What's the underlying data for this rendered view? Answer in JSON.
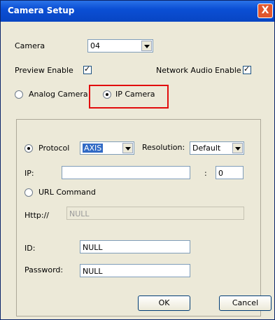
{
  "window": {
    "title": "Camera Setup",
    "close_glyph": "X"
  },
  "camera": {
    "label": "Camera",
    "selected": "04"
  },
  "preview_enable": {
    "label": "Preview Enable",
    "checked": true,
    "mark": "✓"
  },
  "network_audio_enable": {
    "label": "Network Audio Enable",
    "checked": true,
    "mark": "✓"
  },
  "camera_type": {
    "analog_label": "Analog Camera",
    "ip_label": "IP Camera",
    "selected": "IP Camera"
  },
  "ip_panel": {
    "protocol_label": "Protocol",
    "protocol_value": "AXIS",
    "resolution_label": "Resolution:",
    "resolution_value": "Default",
    "ip_label": "IP:",
    "ip_value": "",
    "port_separator": ":",
    "port_value": "0",
    "url_command_label": "URL Command",
    "http_label": "Http://",
    "http_value": "NULL",
    "id_label": "ID:",
    "id_value": "NULL",
    "password_label": "Password:",
    "password_value": "NULL",
    "selected_mode": "Protocol"
  },
  "buttons": {
    "ok": "OK",
    "cancel": "Cancel"
  },
  "colors": {
    "title_bar": "#0b4fd5",
    "highlight_box": "#e20d0d",
    "dialog_bg": "#ece9d8"
  }
}
